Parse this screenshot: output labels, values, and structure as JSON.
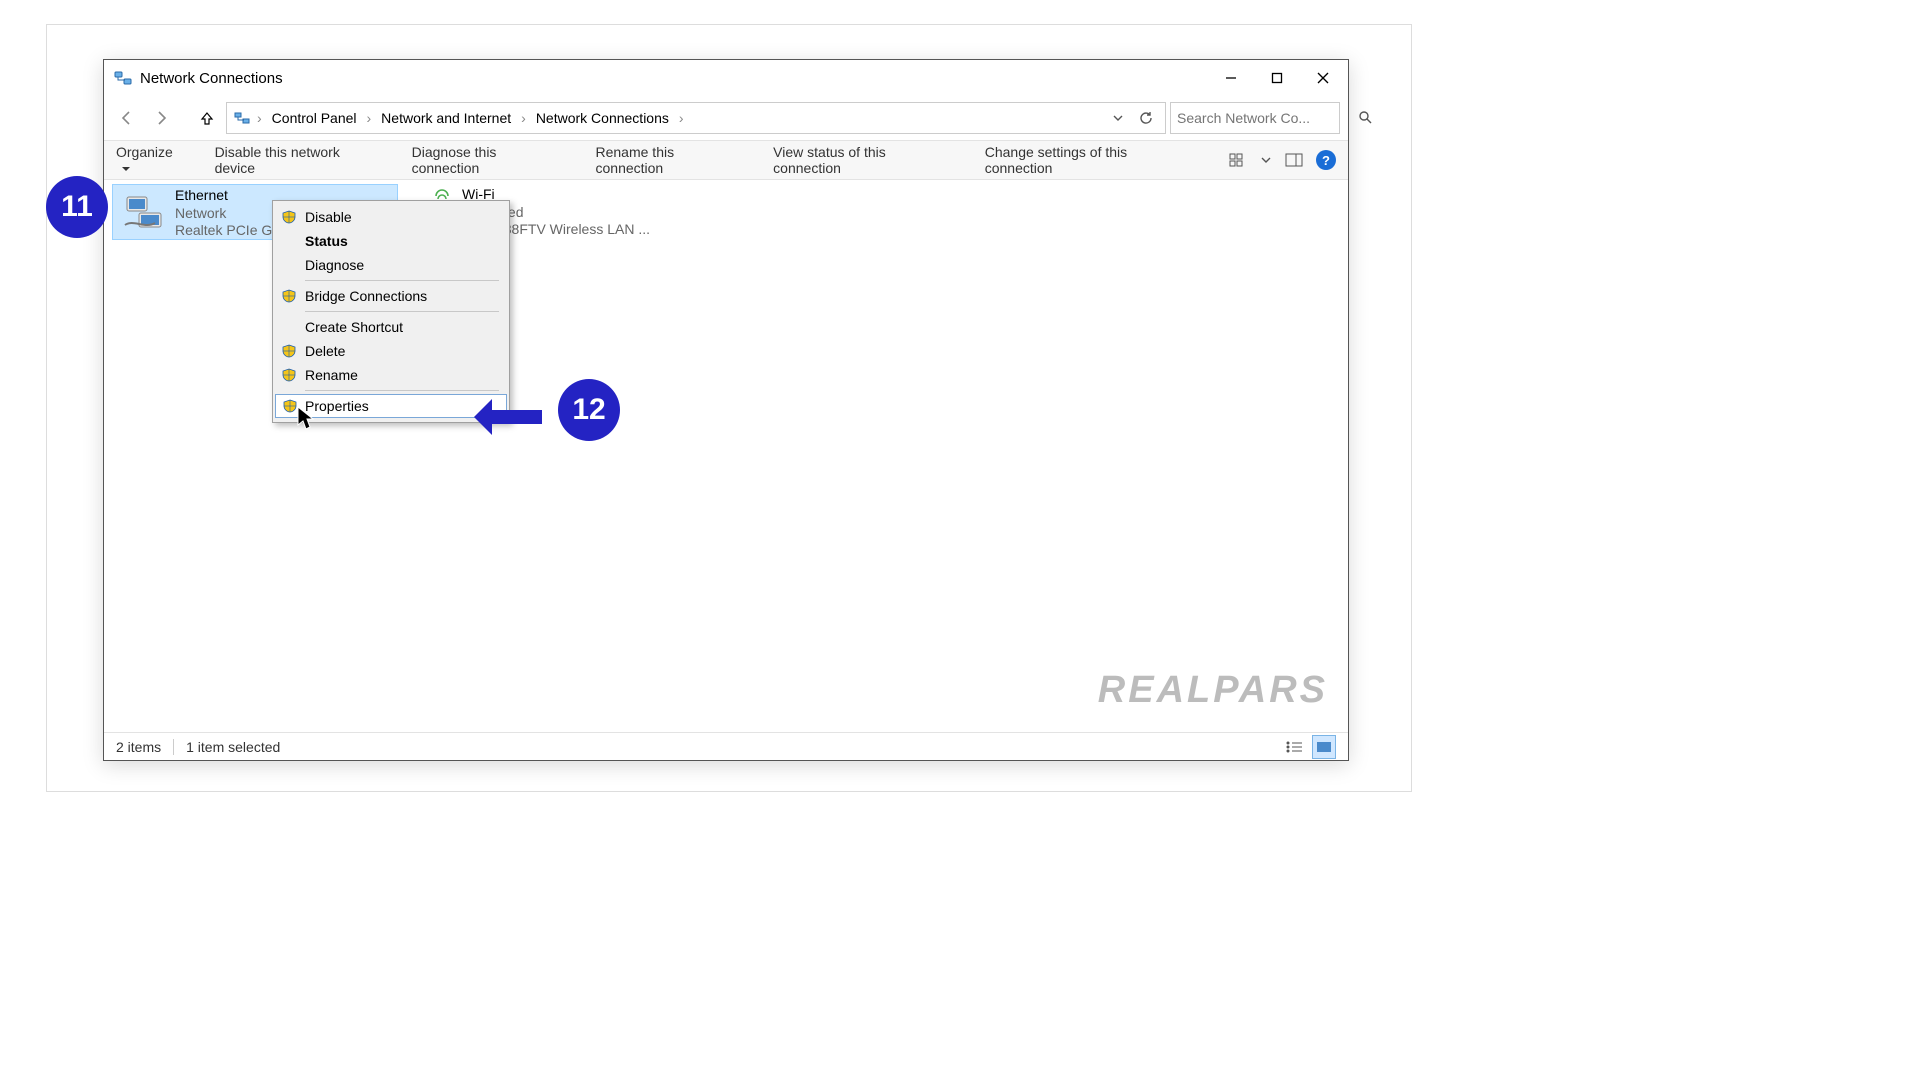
{
  "window": {
    "title": "Network Connections"
  },
  "breadcrumbs": {
    "b0": "Control Panel",
    "b1": "Network and Internet",
    "b2": "Network Connections"
  },
  "search": {
    "placeholder": "Search Network Co..."
  },
  "toolbar": {
    "organize": "Organize",
    "disable": "Disable this network device",
    "diagnose": "Diagnose this connection",
    "rename": "Rename this connection",
    "view_status": "View status of this connection",
    "change_settings": "Change settings of this connection"
  },
  "connections": {
    "ethernet": {
      "name": "Ethernet",
      "status": "Network",
      "device": "Realtek PCIe Gb..."
    },
    "wifi": {
      "name": "Wi-Fi",
      "status": "...nnected",
      "device": "RTL8188FTV Wireless LAN ..."
    }
  },
  "context_menu": {
    "disable": "Disable",
    "status": "Status",
    "diagnose": "Diagnose",
    "bridge": "Bridge Connections",
    "create_shortcut": "Create Shortcut",
    "delete": "Delete",
    "rename": "Rename",
    "properties": "Properties"
  },
  "statusbar": {
    "items": "2 items",
    "selected": "1 item selected"
  },
  "callouts": {
    "c11": "11",
    "c12": "12"
  },
  "watermark": "REALPARS"
}
